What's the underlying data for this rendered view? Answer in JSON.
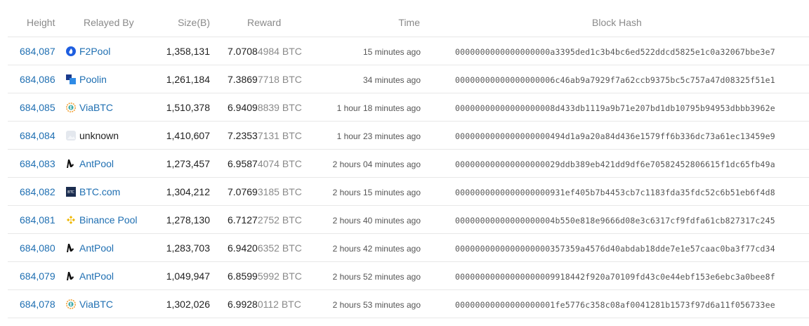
{
  "columns": {
    "height": "Height",
    "relayed_by": "Relayed By",
    "size": "Size(B)",
    "reward": "Reward",
    "time": "Time",
    "hash": "Block Hash"
  },
  "blocks": [
    {
      "height": "684,087",
      "miner": "F2Pool",
      "icon": "f2pool-icon",
      "size": "1,358,131",
      "reward_main": "7.0708",
      "reward_rest": "4984 BTC",
      "time": "15 minutes ago",
      "hash": "0000000000000000000a3395ded1c3b4bc6ed522ddcd5825e1c0a32067bbe3e7"
    },
    {
      "height": "684,086",
      "miner": "Poolin",
      "icon": "poolin-icon",
      "size": "1,261,184",
      "reward_main": "7.3869",
      "reward_rest": "7718 BTC",
      "time": "34 minutes ago",
      "hash": "00000000000000000006c46ab9a7929f7a62ccb9375bc5c757a47d08325f51e1"
    },
    {
      "height": "684,085",
      "miner": "ViaBTC",
      "icon": "viabtc-icon",
      "size": "1,510,378",
      "reward_main": "6.9409",
      "reward_rest": "8839 BTC",
      "time": "1 hour 18 minutes ago",
      "hash": "00000000000000000008d433db1119a9b71e207bd1db10795b94953dbbb3962e"
    },
    {
      "height": "684,084",
      "miner": "unknown",
      "icon": "unknown-icon",
      "size": "1,410,607",
      "reward_main": "7.2353",
      "reward_rest": "7131 BTC",
      "time": "1 hour 23 minutes ago",
      "hash": "0000000000000000000494d1a9a20a84d436e1579ff6b336dc73a61ec13459e9"
    },
    {
      "height": "684,083",
      "miner": "AntPool",
      "icon": "antpool-icon",
      "size": "1,273,457",
      "reward_main": "6.9587",
      "reward_rest": "4074 BTC",
      "time": "2 hours 04 minutes ago",
      "hash": "000000000000000000029ddb389eb421dd9df6e70582452806615f1dc65fb49a"
    },
    {
      "height": "684,082",
      "miner": "BTC.com",
      "icon": "btccom-icon",
      "size": "1,304,212",
      "reward_main": "7.0769",
      "reward_rest": "3185 BTC",
      "time": "2 hours 15 minutes ago",
      "hash": "0000000000000000000931ef405b7b4453cb7c1183fda35fdc52c6b51eb6f4d8"
    },
    {
      "height": "684,081",
      "miner": "Binance Pool",
      "icon": "binance-icon",
      "size": "1,278,130",
      "reward_main": "6.7127",
      "reward_rest": "2752 BTC",
      "time": "2 hours 40 minutes ago",
      "hash": "00000000000000000004b550e818e9666d08e3c6317cf9fdfa61cb827317c245"
    },
    {
      "height": "684,080",
      "miner": "AntPool",
      "icon": "antpool-icon",
      "size": "1,283,703",
      "reward_main": "6.9420",
      "reward_rest": "6352 BTC",
      "time": "2 hours 42 minutes ago",
      "hash": "0000000000000000000357359a4576d40abdab18dde7e1e57caac0ba3f77cd34"
    },
    {
      "height": "684,079",
      "miner": "AntPool",
      "icon": "antpool-icon",
      "size": "1,049,947",
      "reward_main": "6.8599",
      "reward_rest": "5992 BTC",
      "time": "2 hours 52 minutes ago",
      "hash": "00000000000000000009918442f920a70109fd43c0e44ebf153e6ebc3a0bee8f"
    },
    {
      "height": "684,078",
      "miner": "ViaBTC",
      "icon": "viabtc-icon",
      "size": "1,302,026",
      "reward_main": "6.9928",
      "reward_rest": "0112 BTC",
      "time": "2 hours 53 minutes ago",
      "hash": "00000000000000000001fe5776c358c08af0041281b1573f97d6a11f056733ee"
    }
  ],
  "colors": {
    "link": "#1f6fb2",
    "muted": "#8a8a8a",
    "border": "#e8e8e8"
  }
}
